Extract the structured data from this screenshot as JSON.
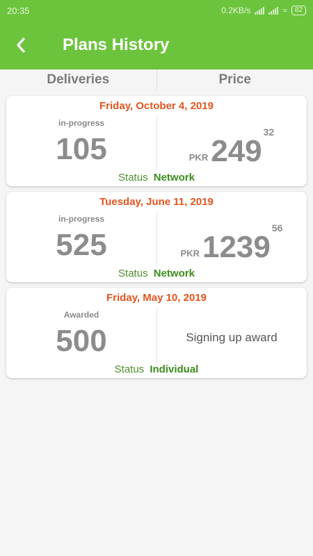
{
  "statusbar": {
    "time": "20:35",
    "speed": "0.2KB/s",
    "battery": "82"
  },
  "appbar": {
    "back_icon": "chevron-left-icon",
    "title": "Plans History"
  },
  "columns": {
    "left": "Deliveries",
    "right": "Price"
  },
  "plans": [
    {
      "date": "Friday, October 4, 2019",
      "state": "in-progress",
      "deliveries": "105",
      "currency": "PKR",
      "price_main": "249",
      "price_decimal": "32",
      "status_label": "Status",
      "status_value": "Network"
    },
    {
      "date": "Tuesday, June 11, 2019",
      "state": "in-progress",
      "deliveries": "525",
      "currency": "PKR",
      "price_main": "1239",
      "price_decimal": "56",
      "status_label": "Status",
      "status_value": "Network"
    },
    {
      "date": "Friday, May 10, 2019",
      "state": "Awarded",
      "deliveries": "500",
      "award_text": "Signing up award",
      "status_label": "Status",
      "status_value": "Individual"
    }
  ],
  "colors": {
    "accent": "#6cc43c",
    "date": "#e1541e",
    "status": "#3c8c1c"
  }
}
